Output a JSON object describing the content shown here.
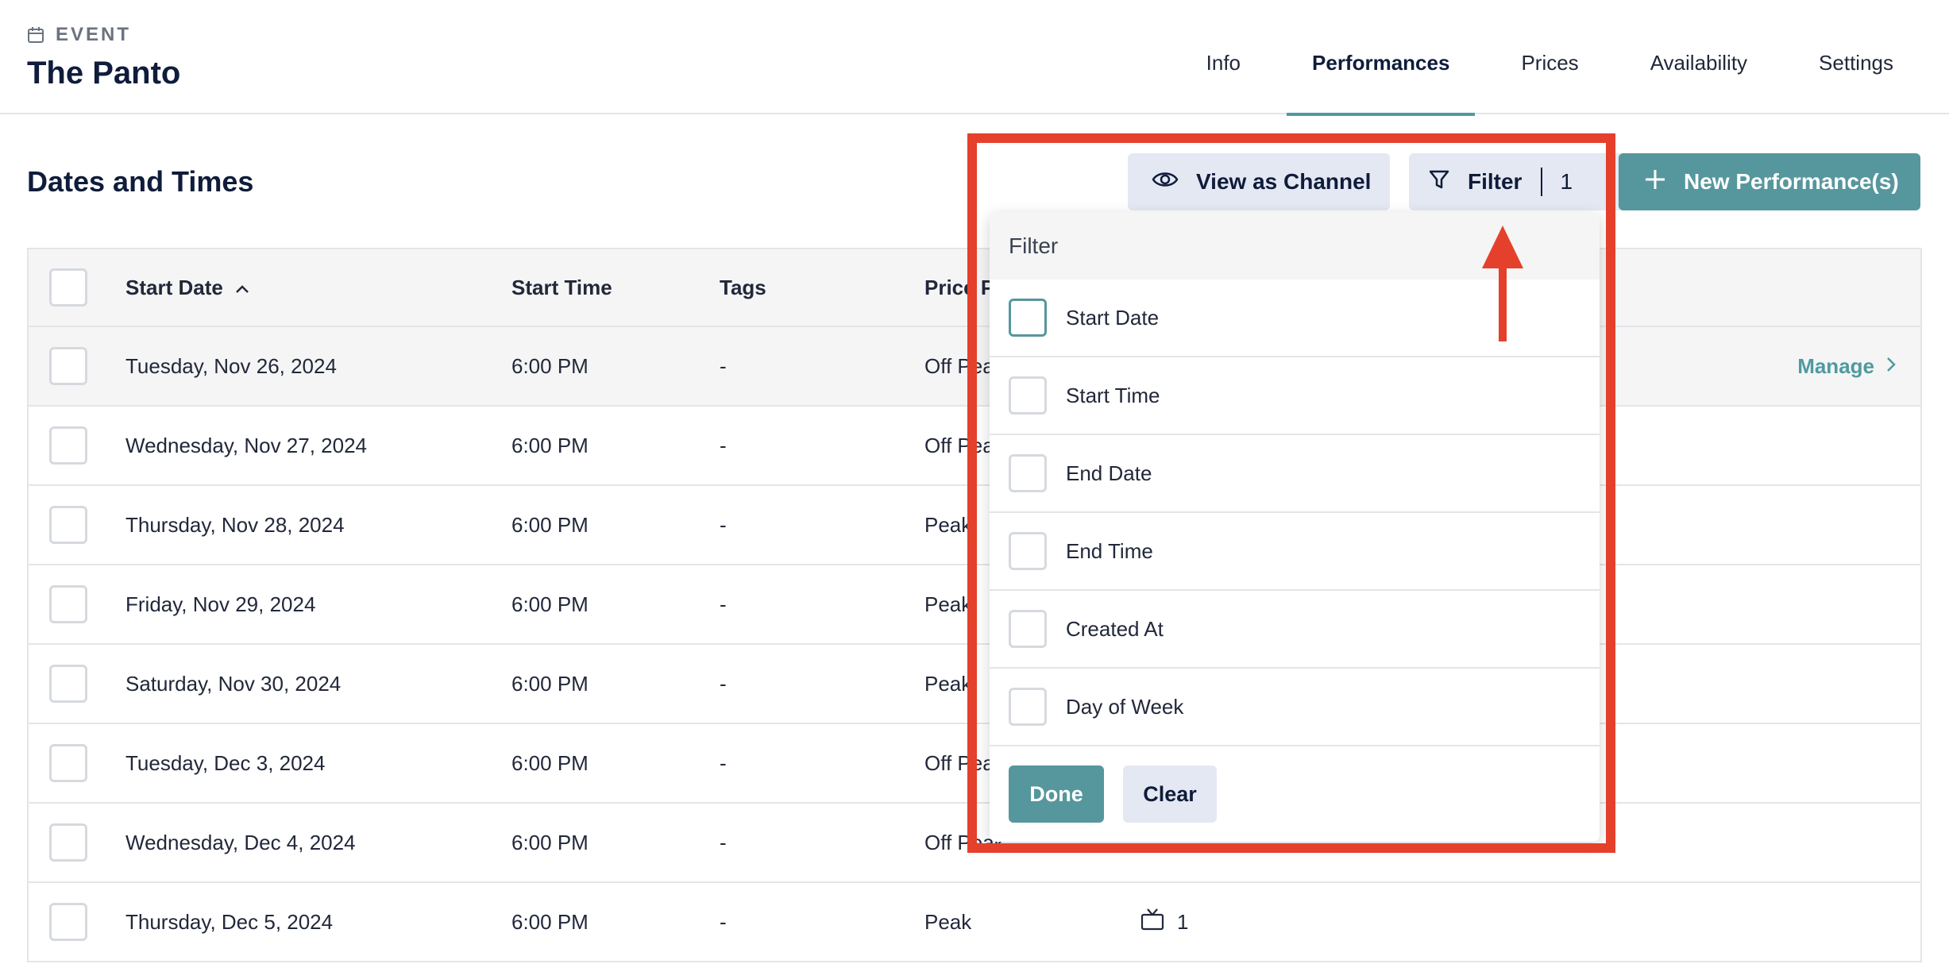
{
  "header": {
    "eyebrow": "EVENT",
    "title": "The Panto",
    "tabs": [
      {
        "label": "Info"
      },
      {
        "label": "Performances"
      },
      {
        "label": "Prices"
      },
      {
        "label": "Availability"
      },
      {
        "label": "Settings"
      }
    ],
    "active_tab": "Performances"
  },
  "section": {
    "title": "Dates and Times",
    "view_as_channel": "View as Channel",
    "filter_label": "Filter",
    "filter_count": "1",
    "new_performance": "New Performance(s)"
  },
  "table": {
    "columns": {
      "start_date": "Start Date",
      "start_time": "Start Time",
      "tags": "Tags",
      "price": "Price P"
    },
    "rows": [
      {
        "date": "Tuesday, Nov 26, 2024",
        "time": "6:00 PM",
        "tags": "-",
        "price": "Off Peak",
        "manage": "Manage"
      },
      {
        "date": "Wednesday, Nov 27, 2024",
        "time": "6:00 PM",
        "tags": "-",
        "price": "Off Pea"
      },
      {
        "date": "Thursday, Nov 28, 2024",
        "time": "6:00 PM",
        "tags": "-",
        "price": "Peak"
      },
      {
        "date": "Friday, Nov 29, 2024",
        "time": "6:00 PM",
        "tags": "-",
        "price": "Peak"
      },
      {
        "date": "Saturday, Nov 30, 2024",
        "time": "6:00 PM",
        "tags": "-",
        "price": "Peak"
      },
      {
        "date": "Tuesday, Dec 3, 2024",
        "time": "6:00 PM",
        "tags": "-",
        "price": "Off Pea"
      },
      {
        "date": "Wednesday, Dec 4, 2024",
        "time": "6:00 PM",
        "tags": "-",
        "price": "Off Peak"
      },
      {
        "date": "Thursday, Dec 5, 2024",
        "time": "6:00 PM",
        "tags": "-",
        "price": "Peak",
        "channels": "1"
      }
    ]
  },
  "filter_popup": {
    "title": "Filter",
    "options": [
      {
        "label": "Start Date"
      },
      {
        "label": "Start Time"
      },
      {
        "label": "End Date"
      },
      {
        "label": "End Time"
      },
      {
        "label": "Created At"
      },
      {
        "label": "Day of Week"
      }
    ],
    "done": "Done",
    "clear": "Clear"
  },
  "colors": {
    "accent": "#56979d",
    "highlight": "#e5402b",
    "navy": "#0f1c3a"
  },
  "icons": [
    "calendar-icon",
    "eye-icon",
    "filter-icon",
    "plus-icon",
    "sort-up-icon",
    "chevron-right-icon",
    "tv-icon",
    "arrow-up-icon"
  ]
}
